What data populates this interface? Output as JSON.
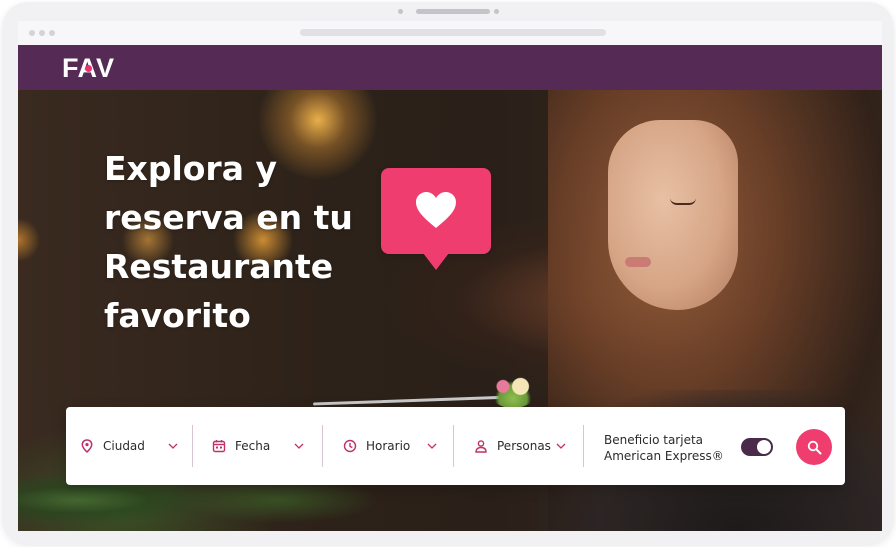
{
  "app": {
    "logo_text": "FAV"
  },
  "hero": {
    "headline": "Explora y reserva en tu Restaurante favorito"
  },
  "search": {
    "city_label": "Ciudad",
    "date_label": "Fecha",
    "time_label": "Horario",
    "people_label": "Personas",
    "benefit_label_line1": "Beneficio tarjeta",
    "benefit_label_line2": "American Express®",
    "benefit_toggle_on": true
  },
  "icons": {
    "location": "location-pin-icon",
    "calendar": "calendar-icon",
    "clock": "clock-icon",
    "person": "person-icon",
    "chevron": "chevron-down-icon",
    "heart": "heart-icon",
    "search": "search-icon"
  },
  "colors": {
    "brand_purple": "#552a55",
    "accent_pink": "#ee3d6e",
    "icon_pink": "#c0306a",
    "toggle_dark": "#4a2a4a"
  }
}
